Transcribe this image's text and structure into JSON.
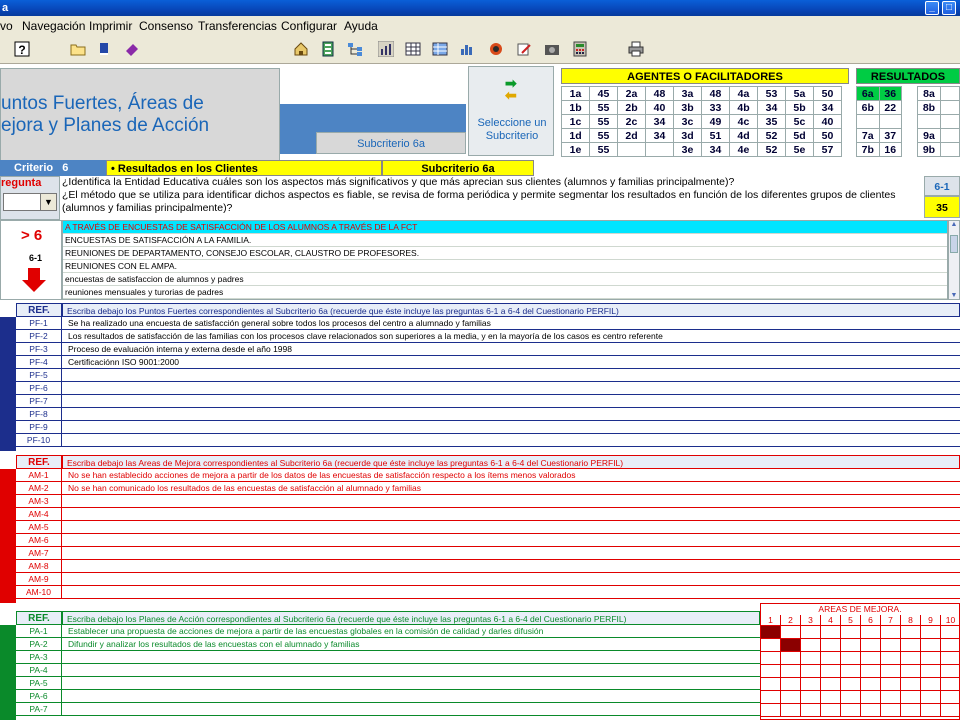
{
  "window": {
    "title": "a"
  },
  "menu": [
    "vo",
    "Navegación",
    "Imprimir",
    "Consenso",
    "Transferencias",
    "Configurar",
    "Ayuda"
  ],
  "header": {
    "title_line1": "untos Fuertes, Áreas de",
    "title_line2": "ejora y Planes de Acción",
    "subcriterio_label": "Subcriterio 6a",
    "select_label": "Seleccione un Subcriterio",
    "agentes_title": "AGENTES O FACILITADORES",
    "resultados_title": "RESULTADOS",
    "agentes_rows": [
      [
        [
          "1a",
          "45"
        ],
        [
          "2a",
          "48"
        ],
        [
          "3a",
          "48"
        ],
        [
          "4a",
          "53"
        ],
        [
          "5a",
          "50"
        ]
      ],
      [
        [
          "1b",
          "55"
        ],
        [
          "2b",
          "40"
        ],
        [
          "3b",
          "33"
        ],
        [
          "4b",
          "34"
        ],
        [
          "5b",
          "34"
        ]
      ],
      [
        [
          "1c",
          "55"
        ],
        [
          "2c",
          "34"
        ],
        [
          "3c",
          "49"
        ],
        [
          "4c",
          "35"
        ],
        [
          "5c",
          "40"
        ]
      ],
      [
        [
          "1d",
          "55"
        ],
        [
          "2d",
          "34"
        ],
        [
          "3d",
          "51"
        ],
        [
          "4d",
          "52"
        ],
        [
          "5d",
          "50"
        ]
      ],
      [
        [
          "1e",
          "55"
        ],
        [
          "",
          ""
        ],
        [
          "3e",
          "34"
        ],
        [
          "4e",
          "52"
        ],
        [
          "5e",
          "57"
        ]
      ]
    ],
    "resultados_rows": [
      [
        [
          "6a",
          "36"
        ],
        [
          "8a",
          ""
        ]
      ],
      [
        [
          "6b",
          "22"
        ],
        [
          "8b",
          ""
        ]
      ],
      [
        [
          "",
          ""
        ],
        [
          "",
          ""
        ]
      ],
      [
        [
          "7a",
          "37"
        ],
        [
          "9a",
          ""
        ]
      ],
      [
        [
          "7b",
          "16"
        ],
        [
          "9b",
          ""
        ]
      ]
    ]
  },
  "criterio": {
    "label": "Criterio",
    "number": "6",
    "name": "• Resultados en los Clientes",
    "sub": "Subcriterio 6a"
  },
  "question": {
    "label": "regunta",
    "text1": "¿Identifica la Entidad Educativa cuáles son los aspectos más significativos y que más aprecian sus clientes (alumnos y familias principalmente)?",
    "text2": "¿El método que se utiliza para identificar dichos aspectos es fiable, se revisa de forma periódica y permite segmentar los resultados en función de los diferentes grupos de clientes (alumnos y familias principalmente)?",
    "code": "6-1",
    "score": "35"
  },
  "evidence": {
    "gt": "> 6",
    "code": "6-1",
    "items": [
      "A TRAVÉS DE ENCUESTAS DE SATISFACCIÓN DE LOS ALUMNOS A TRAVÉS DE LA FCT",
      "ENCUESTAS DE SATISFACCIÓN A LA FAMILIA.",
      "REUNIONES DE DEPARTAMENTO, CONSEJO ESCOLAR, CLAUSTRO DE PROFESORES.",
      "REUNIONES CON EL AMPA.",
      "encuestas de satisfaccion de alumnos y padres",
      "reuniones mensuales y turorias de padres"
    ]
  },
  "pf": {
    "ref": "REF.",
    "header": "Escriba debajo los Puntos Fuertes correspondientes al Subcriterio 6a (recuerde que éste incluye las preguntas 6-1 a 6-4 del Cuestionario PERFIL)",
    "rows": [
      [
        "PF-1",
        "Se ha realizado una encuesta de satisfacción general sobre todos los procesos del centro a alumnado y familias"
      ],
      [
        "PF-2",
        "Los resultados de satisfacción de las familias con los procesos clave relacionados son superiores a la media, y en la mayoría de los casos es centro referente"
      ],
      [
        "PF-3",
        "Proceso de evaluación interna y externa desde el año 1998"
      ],
      [
        "PF-4",
        "Certificaciónn ISO 9001:2000"
      ],
      [
        "PF-5",
        ""
      ],
      [
        "PF-6",
        ""
      ],
      [
        "PF-7",
        ""
      ],
      [
        "PF-8",
        ""
      ],
      [
        "PF-9",
        ""
      ],
      [
        "PF-10",
        ""
      ]
    ]
  },
  "am": {
    "ref": "REF.",
    "header": "Escriba debajo las Areas de Mejora correspondientes al Subcriterio 6a (recuerde que éste incluye las preguntas 6-1 a 6-4 del Cuestionario PERFIL)",
    "rows": [
      [
        "AM-1",
        "No se han establecido acciones de mejora a partir de los datos de las encuestas de satisfacción respecto a los ítems menos valorados"
      ],
      [
        "AM-2",
        "No se han comunicado los resultados de las encuestas de satisfacción al alumnado  y familias"
      ],
      [
        "AM-3",
        ""
      ],
      [
        "AM-4",
        ""
      ],
      [
        "AM-5",
        ""
      ],
      [
        "AM-6",
        ""
      ],
      [
        "AM-7",
        ""
      ],
      [
        "AM-8",
        ""
      ],
      [
        "AM-9",
        ""
      ],
      [
        "AM-10",
        ""
      ]
    ]
  },
  "pa": {
    "ref": "REF.",
    "header": "Escriba debajo los Planes de Acción correspondientes al Subcriterio 6a (recuerde que éste incluye las preguntas 6-1 a 6-4 del Cuestionario PERFIL)",
    "areas_title": "AREAS DE MEJORA.",
    "areas_cols": [
      "1",
      "2",
      "3",
      "4",
      "5",
      "6",
      "7",
      "8",
      "9",
      "10"
    ],
    "rows": [
      [
        "PA-1",
        "Establecer una propuesta de acciones de mejora a partir de las encuestas globales en la comisión de calidad y darles difusión"
      ],
      [
        "PA-2",
        "Difundir y analizar los resultados de las encuestas con el alumnado y familias"
      ],
      [
        "PA-3",
        ""
      ],
      [
        "PA-4",
        ""
      ],
      [
        "PA-5",
        ""
      ],
      [
        "PA-6",
        ""
      ],
      [
        "PA-7",
        ""
      ]
    ]
  },
  "colors": {
    "pf": "#1c2e8c",
    "am": "#e00000",
    "pa": "#0a8a2a",
    "mark": "#8b0000"
  }
}
